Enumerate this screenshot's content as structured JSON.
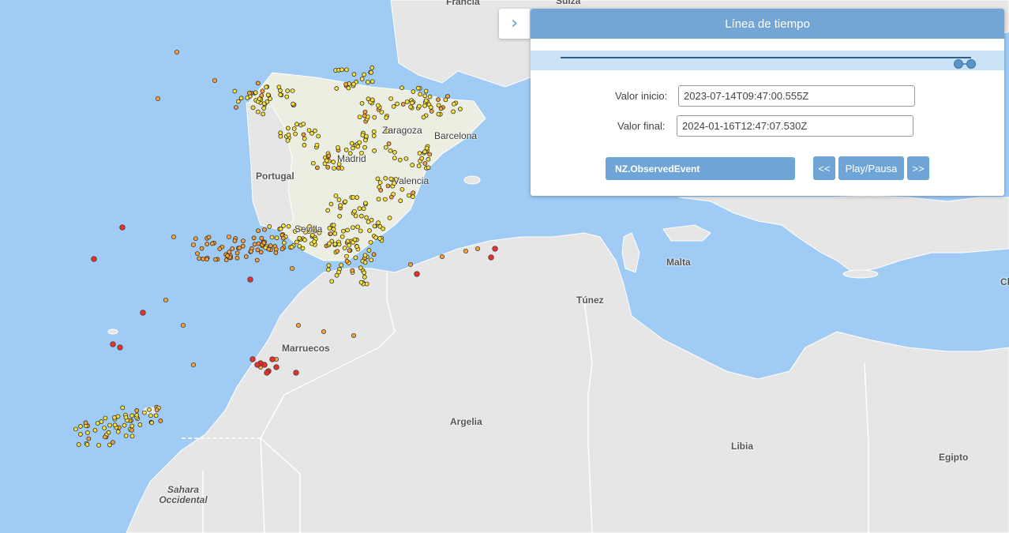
{
  "panel": {
    "title": "Línea de tiempo",
    "start_label": "Valor inicio:",
    "start_value": "2023-07-14T09:47:00.555Z",
    "end_label": "Valor final:",
    "end_value": "2024-01-16T12:47:07.530Z",
    "layer_button": "NZ.ObservedEvent",
    "prev_button": "<<",
    "play_button": "Play/Pausa",
    "next_button": ">>",
    "slider_range": [
      0.97,
      1.0
    ]
  },
  "map": {
    "labels": {
      "francia": "Francia",
      "suiza": "Suiza",
      "zaragoza": "Zaragoza",
      "barcelona": "Barcelona",
      "madrid": "Madrid",
      "portugal": "Portugal",
      "valencia": "Valencia",
      "sevilla": "Sevilla",
      "malta": "Malta",
      "tunez": "Túnez",
      "marruecos": "Marruecos",
      "argelia": "Argelia",
      "libia": "Libia",
      "egipto": "Egipto",
      "sahara_1": "Sahara",
      "sahara_2": "Occidental",
      "chipre_partial": "Cl"
    },
    "colors": {
      "sea": "#9fcbf4",
      "land": "#e6e6e6",
      "spain": "#eceee2",
      "border": "#ffffff",
      "event_yellow": "#f7e03a",
      "event_orange": "#f5a03a",
      "event_red": "#e8312a"
    }
  }
}
